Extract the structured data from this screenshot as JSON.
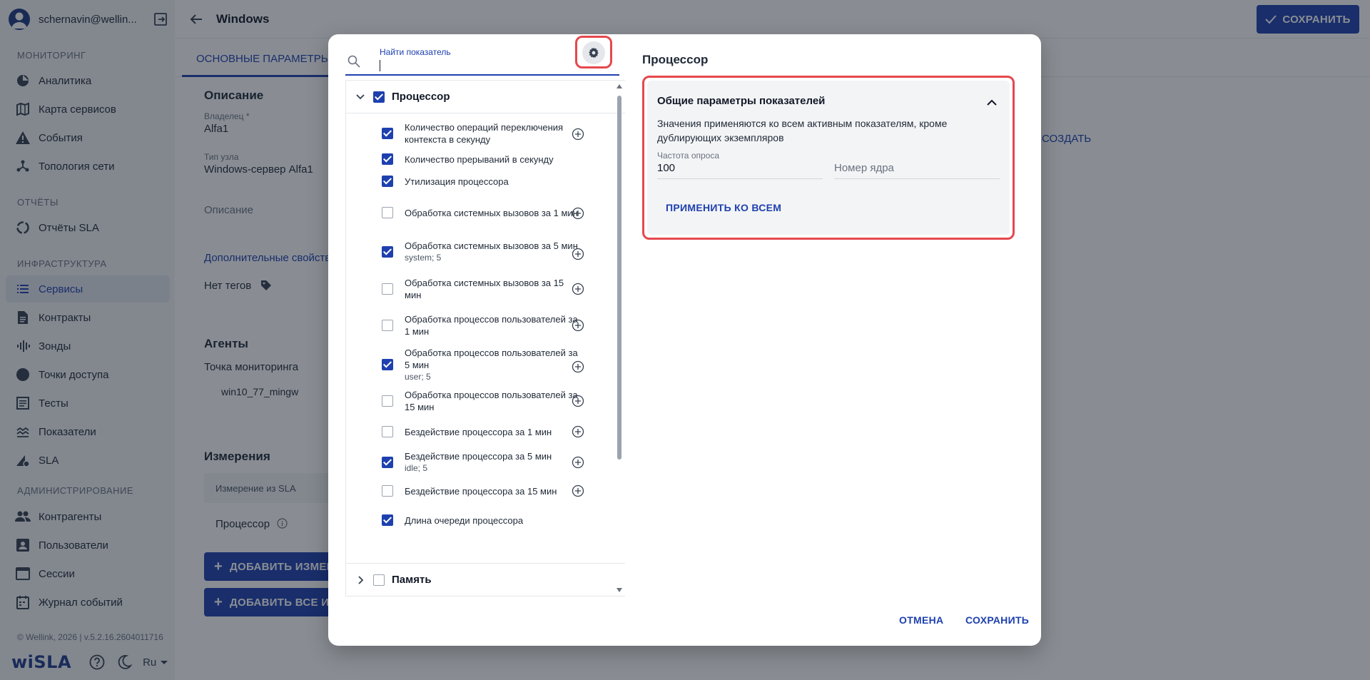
{
  "user": {
    "email": "schernavin@wellin..."
  },
  "sidebar": {
    "sections": [
      {
        "title": "МОНИТОРИНГ"
      },
      {
        "title": "ОТЧЁТЫ"
      },
      {
        "title": "ИНФРАСТРУКТУРА"
      },
      {
        "title": "АДМИНИСТРИРОВАНИЕ"
      }
    ],
    "items": [
      {
        "label": "Аналитика",
        "icon": "pie-chart-icon"
      },
      {
        "label": "Карта сервисов",
        "icon": "map-icon"
      },
      {
        "label": "События",
        "icon": "warning-icon"
      },
      {
        "label": "Топология сети",
        "icon": "network-icon"
      },
      {
        "label": "Отчёты SLA",
        "icon": "report-icon"
      },
      {
        "label": "Сервисы",
        "icon": "list-icon",
        "active": true
      },
      {
        "label": "Контракты",
        "icon": "document-icon"
      },
      {
        "label": "Зонды",
        "icon": "probe-icon"
      },
      {
        "label": "Точки доступа",
        "icon": "circle-icon"
      },
      {
        "label": "Тесты",
        "icon": "tests-icon"
      },
      {
        "label": "Показатели",
        "icon": "metrics-icon"
      },
      {
        "label": "SLA",
        "icon": "sla-icon"
      },
      {
        "label": "Контрагенты",
        "icon": "people-icon"
      },
      {
        "label": "Пользователи",
        "icon": "user-card-icon"
      },
      {
        "label": "Сессии",
        "icon": "window-icon"
      },
      {
        "label": "Журнал событий",
        "icon": "journal-icon"
      }
    ],
    "footer": {
      "copyright": "© Wellink, 2026 | v.5.2.16.2604011716",
      "brand": "wiSLA",
      "lang": "Ru"
    }
  },
  "header": {
    "title": "Windows",
    "save_label": "СОХРАНИТЬ"
  },
  "background": {
    "tab_main": "ОСНОВНЫЕ ПАРАМЕТРЫ",
    "description_heading": "Описание",
    "owner_label": "Владелец *",
    "owner_value": "Alfa1",
    "node_type_label": "Тип узла",
    "node_type_value": "Windows-сервер Alfa1",
    "description_placeholder": "Описание",
    "additional_props": "Дополнительные свойства",
    "no_tags": "Нет тегов",
    "create_link": "СОЗДАТЬ",
    "agents_heading": "Агенты",
    "monitoring_point_label": "Точка мониторинга",
    "monitoring_point_value": "win10_77_mingw",
    "measurements_heading": "Измерения",
    "measurement_from_sla": "Измерение из SLA",
    "measurement_row": "Процессор",
    "add_measurement": "ДОБАВИТЬ ИЗМЕРЕ",
    "add_all_measurements": "ДОБАВИТЬ ВСЕ ИЗ"
  },
  "modal": {
    "search": {
      "label": "Найти показатель",
      "value": ""
    },
    "group_processor": {
      "label": "Процессор",
      "checked": true
    },
    "group_memory": {
      "label": "Память",
      "checked": false
    },
    "metrics": [
      {
        "text": "Количество операций переключения контекста в секунду",
        "sub": "",
        "checked": true,
        "add": true
      },
      {
        "text": "Количество прерываний в секунду",
        "sub": "",
        "checked": true,
        "add": false
      },
      {
        "text": "Утилизация процессора",
        "sub": "",
        "checked": true,
        "add": false
      },
      {
        "text": "Обработка системных вызовов за 1 мин",
        "sub": "",
        "checked": false,
        "add": true
      },
      {
        "text": "Обработка системных вызовов за 5 мин",
        "sub": "system; 5",
        "checked": true,
        "add": true
      },
      {
        "text": "Обработка системных вызовов за 15 мин",
        "sub": "",
        "checked": false,
        "add": true
      },
      {
        "text": "Обработка процессов пользователей за 1 мин",
        "sub": "",
        "checked": false,
        "add": true
      },
      {
        "text": "Обработка процессов пользователей за 5 мин",
        "sub": "user; 5",
        "checked": true,
        "add": true
      },
      {
        "text": "Обработка процессов пользователей за 15 мин",
        "sub": "",
        "checked": false,
        "add": true
      },
      {
        "text": "Бездействие процессора за 1 мин",
        "sub": "",
        "checked": false,
        "add": true
      },
      {
        "text": "Бездействие процессора за 5 мин",
        "sub": "idle; 5",
        "checked": true,
        "add": true
      },
      {
        "text": "Бездействие процессора за 15 мин",
        "sub": "",
        "checked": false,
        "add": true
      },
      {
        "text": "Длина очереди процессора",
        "sub": "",
        "checked": true,
        "add": false
      }
    ],
    "right_title": "Процессор",
    "params": {
      "title": "Общие параметры показателей",
      "description": "Значения применяются ко всем активным показателям, кроме дублирующих экземпляров",
      "poll_label": "Частота опроса",
      "poll_value": "100",
      "core_placeholder": "Номер ядра",
      "apply_label": "ПРИМЕНИТЬ КО ВСЕМ"
    },
    "cancel_label": "ОТМЕНА",
    "save_label": "СОХРАНИТЬ"
  },
  "colors": {
    "accent": "#1e40af",
    "highlight": "#e5484d",
    "sidebar_bg": "#f3f4f6"
  }
}
